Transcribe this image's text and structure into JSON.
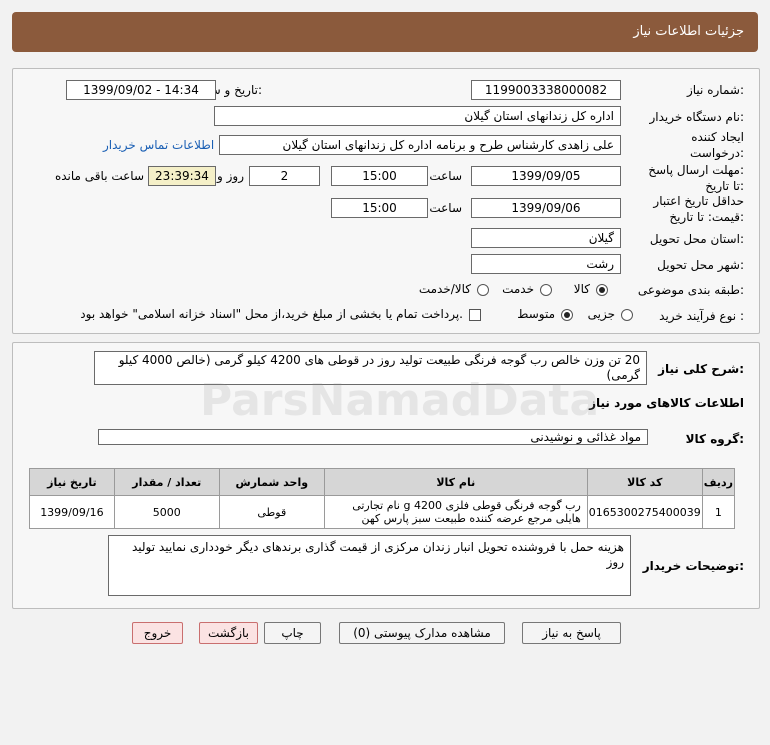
{
  "header": {
    "title": "جزئیات اطلاعات نیاز"
  },
  "details": {
    "need_number_label": "شماره نیاز:",
    "need_number": "1199003338000082",
    "announce_label": "تاریخ و ساعت اعلان عمومی:",
    "announce_value": "1399/09/02 - 14:34",
    "buyer_org_label": "نام دستگاه خریدار:",
    "buyer_org": "اداره کل زندانهای استان گیلان",
    "creator_label": "ایجاد کننده درخواست:",
    "creator": "علی زاهدی کارشناس طرح و برنامه اداره کل زندانهای استان گیلان",
    "contact_link": "اطلاعات تماس خریدار",
    "deadline_label": "مهلت ارسال پاسخ: تا تاریخ:",
    "deadline_date": "1399/09/05",
    "time_label": "ساعت",
    "deadline_time": "15:00",
    "days_value": "2",
    "days_label": "روز و",
    "remaining_time": "23:39:34",
    "remaining_label": "ساعت باقی مانده",
    "validity_label": "حداقل تاریخ اعتبار قیمت: تا تاریخ:",
    "validity_date": "1399/09/06",
    "validity_time": "15:00",
    "province_label": "استان محل تحویل:",
    "province": "گیلان",
    "city_label": "شهر محل تحویل:",
    "city": "رشت",
    "category_label": "طبقه بندی موضوعی:",
    "category_options": [
      "کالا",
      "خدمت",
      "کالا/خدمت"
    ],
    "process_label": "نوع فرآیند خرید :",
    "process_options": [
      "جزیی",
      "متوسط"
    ],
    "payment_note": "پرداخت تمام یا بخشی از مبلغ خرید،از محل \"اسناد خزانه اسلامی\" خواهد بود."
  },
  "description": {
    "label": "شرح کلی نیاز:",
    "text": "20 تن وزن خالص  رب  گوجه فرنگی طبیعت تولید روز در قوطی های 4200 کیلو گرمی (خالص 4000 کیلو گرمی)"
  },
  "goods": {
    "section_title": "اطلاعات کالاهای مورد نیاز",
    "group_label": "گروه کالا:",
    "group_value": "مواد غذائی و نوشیدنی",
    "columns": [
      "ردیف",
      "کد کالا",
      "نام کالا",
      "واحد شمارش",
      "تعداد / مقدار",
      "تاریخ نیاز"
    ],
    "rows": [
      {
        "row": "1",
        "code": "0165300275400039",
        "name": "رب گوجه فرنگی قوطی فلزی 4200 g نام تجارتی هایلی مرجع عرضه کننده طبیعت سبز پارس کهن",
        "unit": "قوطی",
        "qty": "5000",
        "date": "1399/09/16"
      }
    ]
  },
  "buyer_notes": {
    "label": "توضیحات خریدار:",
    "text": "هزینه حمل با فروشنده تحویل انبار زندان مرکزی   از قیمت گذاری برندهای دیگر خودداری نمایید  تولید روز"
  },
  "buttons": {
    "reply": "پاسخ به نیاز",
    "attachments": "مشاهده مدارک پیوستی (0)",
    "print": "چاپ",
    "back": "بازگشت",
    "exit": "خروج"
  },
  "watermark": {
    "text": "ParsNamadData"
  },
  "colors": {
    "header_bg": "#8b5a3c",
    "timer_bg": "#f5f0c8",
    "link": "#1a5fb4"
  }
}
